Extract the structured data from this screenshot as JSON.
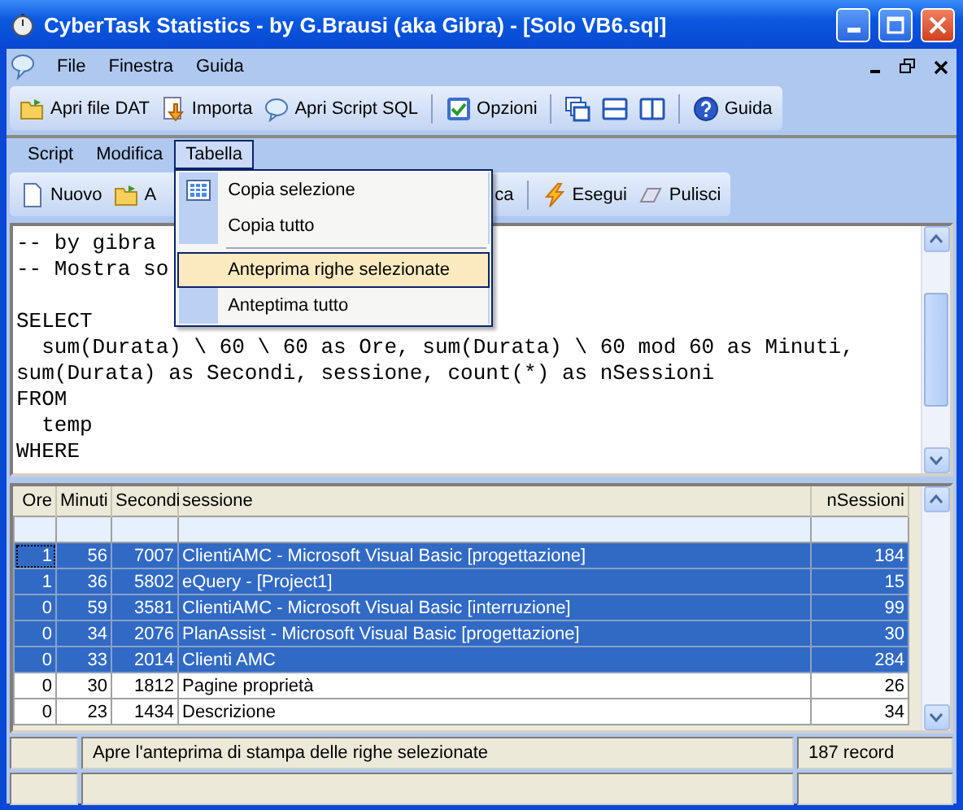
{
  "window": {
    "title": "CyberTask Statistics - by G.Brausi (aka Gibra) - [Solo VB6.sql]"
  },
  "menu_bar": [
    "File",
    "Finestra",
    "Guida"
  ],
  "toolbar": [
    {
      "kind": "folder",
      "label": "Apri file DAT"
    },
    {
      "kind": "import",
      "label": "Importa"
    },
    {
      "kind": "bubble",
      "label": "Apri Script SQL"
    },
    {
      "kind": "separator"
    },
    {
      "kind": "check",
      "label": "Opzioni"
    },
    {
      "kind": "separator"
    },
    {
      "kind": "cascade"
    },
    {
      "kind": "hsplit"
    },
    {
      "kind": "vsplit"
    },
    {
      "kind": "separator"
    },
    {
      "kind": "help",
      "label": "Guida"
    }
  ],
  "child_menu": [
    {
      "label": "Script",
      "selected": false
    },
    {
      "label": "Modifica",
      "selected": false
    },
    {
      "label": "Tabella",
      "selected": true
    }
  ],
  "child_toolbar": [
    {
      "kind": "page",
      "label": "Nuovo"
    },
    {
      "kind": "folder",
      "label": "A"
    },
    {
      "kind": "covered"
    },
    {
      "kind": "plain",
      "label": "ca"
    },
    {
      "kind": "separator"
    },
    {
      "kind": "bolt",
      "label": "Esegui"
    },
    {
      "kind": "eraser",
      "label": "Pulisci"
    }
  ],
  "dropdown": [
    {
      "kind": "grid",
      "label": "Copia selezione",
      "selected": false
    },
    {
      "kind": "plain",
      "label": "Copia tutto",
      "selected": false
    },
    {
      "kind": "separator"
    },
    {
      "kind": "plain",
      "label": "Anteprima righe selezionate",
      "selected": true
    },
    {
      "kind": "plain",
      "label": "Anteptima tutto",
      "selected": false
    }
  ],
  "editor": {
    "lines": [
      {
        "kind": "text",
        "text": "-- by gibra"
      },
      {
        "kind": "text",
        "text": "-- Mostra so"
      },
      {
        "kind": "blank"
      },
      {
        "kind": "text",
        "text": "SELECT"
      },
      {
        "kind": "text",
        "text": "  sum(Durata) \\ 60 \\ 60 as Ore, sum(Durata) \\ 60 mod 60 as Minuti,"
      },
      {
        "kind": "text",
        "text": "sum(Durata) as Secondi, sessione, count(*) as nSessioni"
      },
      {
        "kind": "text",
        "text": "FROM"
      },
      {
        "kind": "text",
        "text": "  temp"
      },
      {
        "kind": "text",
        "text": "WHERE"
      }
    ]
  },
  "table": {
    "columns": [
      "Ore",
      "Minuti",
      "Secondi",
      "sessione",
      "nSessioni"
    ],
    "rows": [
      {
        "cells": [
          "1",
          "56",
          "7007",
          "ClientiAMC - Microsoft Visual Basic [progettazione]",
          "184"
        ],
        "selected": true
      },
      {
        "cells": [
          "1",
          "36",
          "5802",
          "eQuery - [Project1]",
          "15"
        ],
        "selected": true
      },
      {
        "cells": [
          "0",
          "59",
          "3581",
          "ClientiAMC - Microsoft Visual Basic [interruzione]",
          "99"
        ],
        "selected": true
      },
      {
        "cells": [
          "0",
          "34",
          "2076",
          "PlanAssist - Microsoft Visual Basic [progettazione]",
          "30"
        ],
        "selected": true
      },
      {
        "cells": [
          "0",
          "33",
          "2014",
          "Clienti AMC",
          "284"
        ],
        "selected": true
      },
      {
        "cells": [
          "0",
          "30",
          "1812",
          "Pagine proprietà",
          "26"
        ],
        "selected": false
      },
      {
        "cells": [
          "0",
          "23",
          "1434",
          "Descrizione",
          "34"
        ],
        "selected": false
      }
    ]
  },
  "status_bar": {
    "message": "Apre l'anteprima di stampa delle righe selezionate",
    "count": "187 record"
  }
}
